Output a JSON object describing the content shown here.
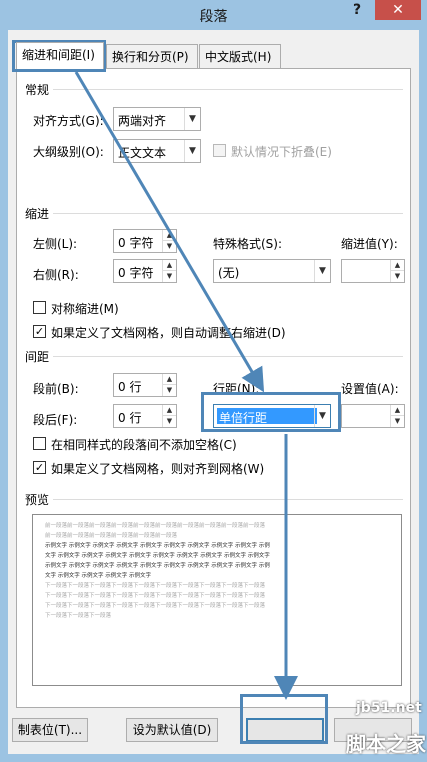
{
  "window": {
    "title": "段落",
    "help_label": "?",
    "close_label": "✕"
  },
  "tabs": [
    {
      "label": "缩进和间距(I)"
    },
    {
      "label": "换行和分页(P)"
    },
    {
      "label": "中文版式(H)"
    }
  ],
  "general": {
    "heading": "常规",
    "alignment": {
      "label": "对齐方式(G):",
      "value": "两端对齐"
    },
    "outline": {
      "label": "大纲级别(O):",
      "value": "正文文本"
    },
    "collapse": {
      "label": "默认情况下折叠(E)",
      "checked": false,
      "disabled": true
    }
  },
  "indent": {
    "heading": "缩进",
    "left": {
      "label": "左侧(L):",
      "value": "0 字符"
    },
    "right": {
      "label": "右侧(R):",
      "value": "0 字符"
    },
    "special": {
      "label": "特殊格式(S):",
      "value": "(无)"
    },
    "indent_by": {
      "label": "缩进值(Y):",
      "value": ""
    },
    "mirror": {
      "label": "对称缩进(M)",
      "checked": false
    },
    "auto_grid": {
      "label": "如果定义了文档网格，则自动调整右缩进(D)",
      "checked": true
    }
  },
  "spacing": {
    "heading": "间距",
    "before": {
      "label": "段前(B):",
      "value": "0 行"
    },
    "after": {
      "label": "段后(F):",
      "value": "0 行"
    },
    "line": {
      "label": "行距(N):",
      "value": "单倍行距"
    },
    "at": {
      "label": "设置值(A):",
      "value": ""
    },
    "no_space": {
      "label": "在相同样式的段落间不添加空格(C)",
      "checked": false
    },
    "snap_grid": {
      "label": "如果定义了文档网格，则对齐到网格(W)",
      "checked": true
    }
  },
  "preview": {
    "heading": "预览",
    "lines": [
      {
        "text": "前一段落前一段落前一段落前一段落前一段落前一段落前一段落前一段落前一段落前一段落",
        "tone": "gray"
      },
      {
        "text": "前一段落前一段落前一段落前一段落前一段落前一段落",
        "tone": "gray"
      },
      {
        "text": "示例文字 示例文字 示例文字 示例文字 示例文字 示例文字 示例文字 示例文字 示例文字 示例",
        "tone": "dark"
      },
      {
        "text": "文字 示例文字 示例文字 示例文字 示例文字 示例文字 示例文字 示例文字 示例文字 示例文字",
        "tone": "dark"
      },
      {
        "text": "示例文字 示例文字 示例文字 示例文字 示例文字 示例文字 示例文字 示例文字 示例文字 示例",
        "tone": "dark"
      },
      {
        "text": "文字 示例文字 示例文字 示例文字 示例文字",
        "tone": "dark"
      },
      {
        "text": "下一段落下一段落下一段落下一段落下一段落下一段落下一段落下一段落下一段落下一段落",
        "tone": "gray"
      },
      {
        "text": "下一段落下一段落下一段落下一段落下一段落下一段落下一段落下一段落下一段落下一段落",
        "tone": "gray"
      },
      {
        "text": "下一段落下一段落下一段落下一段落下一段落下一段落下一段落下一段落下一段落下一段落",
        "tone": "gray"
      },
      {
        "text": "下一段落下一段落下一段落",
        "tone": "gray"
      }
    ]
  },
  "buttons": {
    "tabs_label": "制表位(T)...",
    "default_label": "设为默认值(D)",
    "ok_label": "",
    "cancel_label": ""
  },
  "watermark": {
    "site": "jb51.net",
    "brand": "脚本之家"
  },
  "colors": {
    "accent": "#3399ff",
    "annotation": "#4f86b7",
    "close": "#c7504a"
  }
}
